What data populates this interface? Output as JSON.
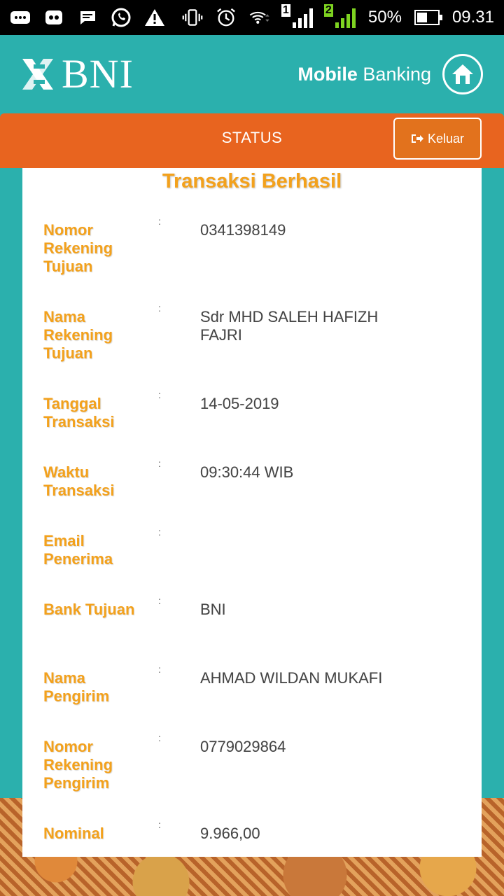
{
  "status_bar": {
    "icons_left": [
      "more-icon",
      "reddit-icon",
      "messages-icon",
      "whatsapp-icon",
      "warning-icon"
    ],
    "icons_right": [
      "vibrate-icon",
      "alarm-icon",
      "wifi-icon"
    ],
    "sim1_label": "1",
    "sim2_label": "2",
    "battery": "50%",
    "battery_level": 0.5,
    "time": "09.31"
  },
  "header": {
    "logo_text": "BNI",
    "app_title_bold": "Mobile",
    "app_title_rest": "Banking"
  },
  "toolbar": {
    "title": "STATUS",
    "logout_label": "Keluar"
  },
  "receipt": {
    "title": "Transaksi Berhasil",
    "separator": ":",
    "rows": [
      {
        "label": "Nomor Rekening Tujuan",
        "value": "0341398149"
      },
      {
        "label": "Nama Rekening Tujuan",
        "value": "Sdr MHD SALEH HAFIZH FAJRI"
      },
      {
        "label": "Tanggal Transaksi",
        "value": "14-05-2019"
      },
      {
        "label": "Waktu Transaksi",
        "value": "09:30:44 WIB"
      },
      {
        "label": "Email Penerima",
        "value": ""
      },
      {
        "label": "Bank Tujuan",
        "value": "BNI"
      },
      {
        "label": "Nama Pengirim",
        "value": "AHMAD WILDAN MUKAFI"
      },
      {
        "label": "Nomor Rekening Pengirim",
        "value": "0779029864"
      },
      {
        "label": "Nominal",
        "value": "9.966,00"
      }
    ]
  }
}
